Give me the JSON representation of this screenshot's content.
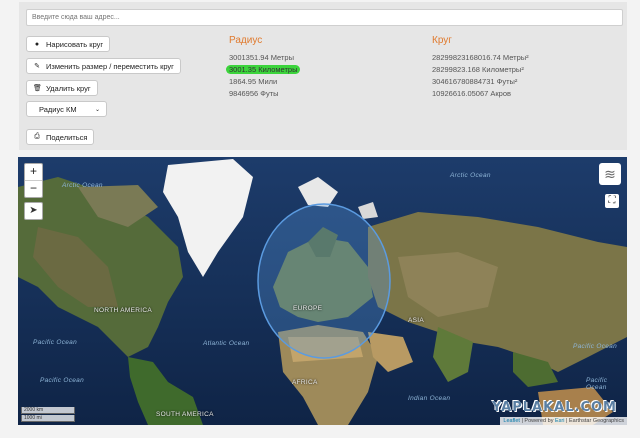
{
  "address": {
    "placeholder": "Введите сюда ваш адрес..."
  },
  "buttons": {
    "draw": "Нарисовать круг",
    "resize": "Изменить размер / переместить круг",
    "delete": "Удалить круг",
    "share": "Поделиться"
  },
  "radius_select": {
    "value": "Радиус КМ"
  },
  "radius": {
    "heading": "Радиус",
    "meters": "3001351.94 Метры",
    "km": "3001.35 Километры",
    "miles": "1864.95 Мили",
    "feet": "9846956 Футы"
  },
  "circle": {
    "heading": "Круг",
    "sq_meters": "28299823168016.74 Метры²",
    "sq_km": "28299823.168 Километры²",
    "sq_feet": "304616780884731 Футы²",
    "acres": "10926616.05067 Акров"
  },
  "map": {
    "zoom_in": "+",
    "zoom_out": "−",
    "labels": {
      "north_america": "NORTH AMERICA",
      "europe": "EUROPE",
      "asia": "ASIA",
      "africa": "AFRICA",
      "south_america": "SOUTH AMERICA"
    },
    "oceans": {
      "arctic_left": "Arctic Ocean",
      "arctic_right": "Arctic Ocean",
      "atlantic": "Atlantic Ocean",
      "pacific_left": "Pacific Ocean",
      "pacific_right": "Pacific Ocean",
      "pacific_lower_left": "Pacific Ocean",
      "pacific_lower_right": "Pacific Ocean",
      "indian": "Indian Ocean"
    },
    "scale_km": "2000 km",
    "scale_mi": "1000 mi",
    "attribution_leaflet": "Leaflet",
    "attribution_powered": "| Powered by",
    "attribution_esri": "Esri",
    "attribution_rest": "| Earthstar Geographics",
    "watermark": "YAPLAKAL.COM"
  },
  "colors": {
    "heading_orange": "#e07a2e",
    "highlight_green": "#3cd43c",
    "circle_blue": "#5b9be0"
  }
}
